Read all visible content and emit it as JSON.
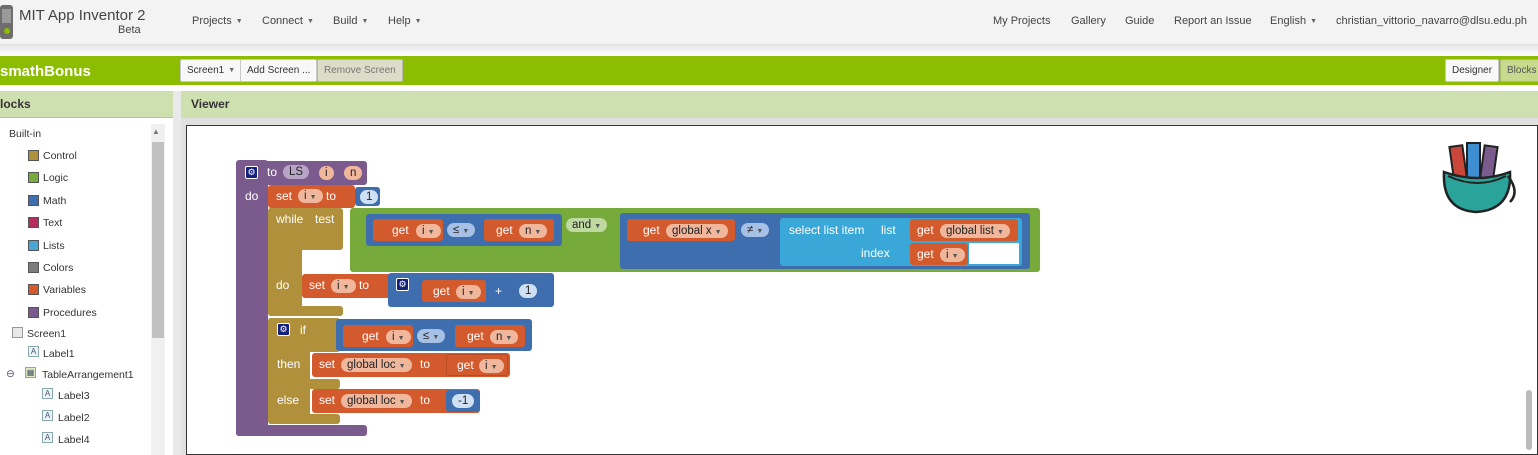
{
  "app": {
    "title": "MIT App Inventor 2",
    "subtitle": "Beta"
  },
  "top_menu": {
    "projects": "Projects",
    "connect": "Connect",
    "build": "Build",
    "help": "Help"
  },
  "top_right": {
    "my_projects": "My Projects",
    "gallery": "Gallery",
    "guide": "Guide",
    "report": "Report an Issue",
    "language": "English",
    "account": "christian_vittorio_navarro@dlsu.edu.ph"
  },
  "project": {
    "name": "smathBonus",
    "screen_select": "Screen1",
    "add_screen": "Add Screen ...",
    "remove_screen": "Remove Screen",
    "designer": "Designer",
    "blocks": "Blocks"
  },
  "sidebar": {
    "header": "locks",
    "builtin": "Built-in",
    "builtin_items": [
      {
        "label": "Control",
        "color": "#b0903a"
      },
      {
        "label": "Logic",
        "color": "#76ab3c"
      },
      {
        "label": "Math",
        "color": "#3f6eae"
      },
      {
        "label": "Text",
        "color": "#b32d5e"
      },
      {
        "label": "Lists",
        "color": "#49a6d4"
      },
      {
        "label": "Colors",
        "color": "#7d7d7d"
      },
      {
        "label": "Variables",
        "color": "#d35a2c"
      },
      {
        "label": "Procedures",
        "color": "#7b5b8d"
      }
    ],
    "components": {
      "screen": "Screen1",
      "label1": "Label1",
      "table": "TableArrangement1",
      "label3": "Label3",
      "label2": "Label2",
      "label4": "Label4"
    },
    "toggle_minus": "⊖"
  },
  "viewer": {
    "header": "Viewer"
  },
  "blocks": {
    "proc_to": "to",
    "proc_name": "LS",
    "param_i": "i",
    "param_n": "n",
    "proc_do": "do",
    "set1": {
      "set": "set",
      "var": "i",
      "to": "to",
      "value": "1"
    },
    "while": {
      "while": "while",
      "test": "test",
      "do": "do"
    },
    "cmp1": {
      "get": "get",
      "left": "i",
      "op": "≤",
      "get2": "get",
      "right": "n"
    },
    "and": "and",
    "cmp2": {
      "get": "get",
      "left": "global x",
      "op": "≠"
    },
    "select": {
      "label": "select list item",
      "list": "list",
      "index": "index",
      "get_list": "get",
      "list_var": "global list",
      "get_idx": "get",
      "idx_var": "i"
    },
    "set2": {
      "set": "set",
      "var": "i",
      "to": "to",
      "get": "get",
      "getvar": "i",
      "plus": "+",
      "num": "1"
    },
    "if": {
      "if": "if",
      "then": "then",
      "else": "else",
      "get": "get",
      "left": "i",
      "op": "≤",
      "get2": "get",
      "right": "n"
    },
    "then_set": {
      "set": "set",
      "var": "global loc",
      "to": "to",
      "get": "get",
      "getvar": "i"
    },
    "else_set": {
      "set": "set",
      "var": "global loc",
      "to": "to",
      "num": "-1"
    }
  }
}
